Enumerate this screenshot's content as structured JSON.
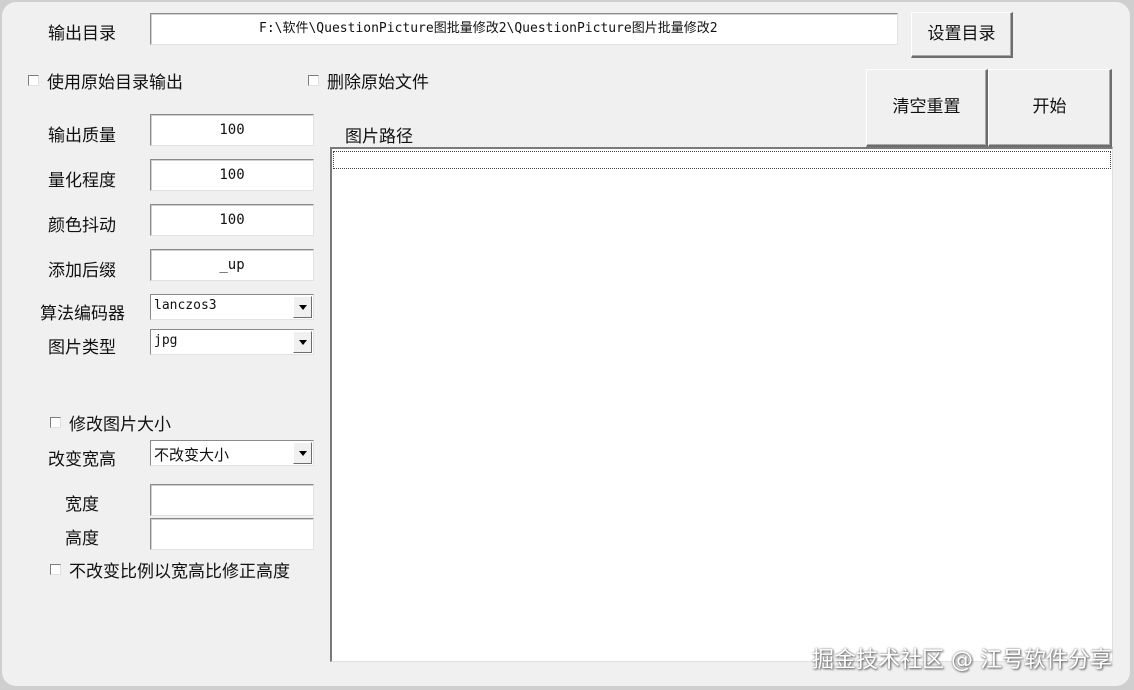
{
  "output_dir": {
    "label": "输出目录",
    "value": "F:\\软件\\QuestionPicture图批量修改2\\QuestionPicture图片批量修改2",
    "set_button": "设置目录"
  },
  "options": {
    "use_original_dir": "使用原始目录输出",
    "delete_original": "删除原始文件"
  },
  "actions": {
    "clear_reset": "清空重置",
    "start": "开始"
  },
  "settings": {
    "quality_label": "输出质量",
    "quality_value": "100",
    "quantize_label": "量化程度",
    "quantize_value": "100",
    "dither_label": "颜色抖动",
    "dither_value": "100",
    "suffix_label": "添加后缀",
    "suffix_value": "_up",
    "codec_label": "算法编码器",
    "codec_value": "lanczos3",
    "type_label": "图片类型",
    "type_value": "jpg"
  },
  "resize": {
    "modify_size": "修改图片大小",
    "change_label": "改变宽高",
    "change_value": "不改变大小",
    "width_label": "宽度",
    "width_value": "",
    "height_label": "高度",
    "height_value": "",
    "keep_ratio": "不改变比例以宽高比修正高度"
  },
  "list": {
    "header": "图片路径"
  },
  "watermark": "掘金技术社区 @ 江号软件分享"
}
